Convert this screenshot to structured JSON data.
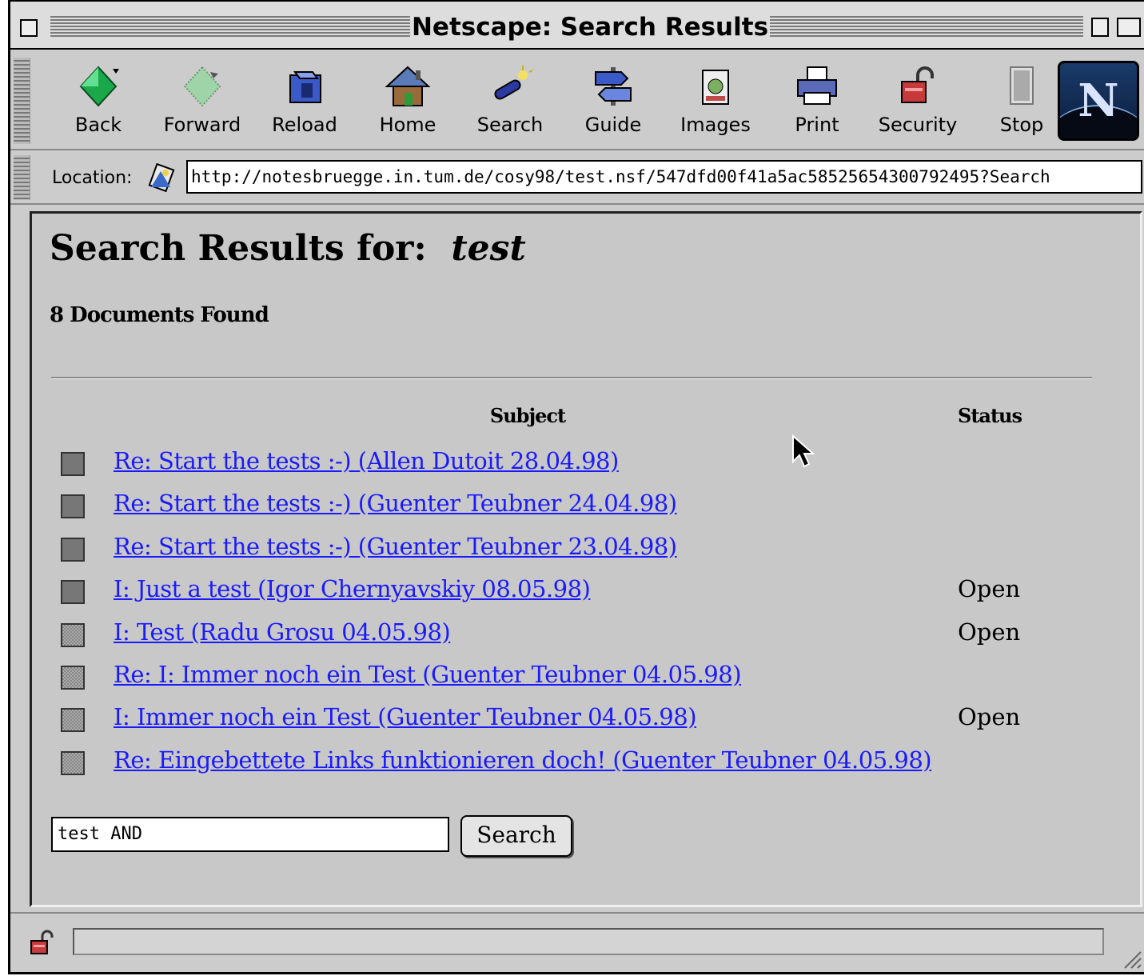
{
  "window": {
    "title": "Netscape: Search Results"
  },
  "toolbar": {
    "buttons": [
      {
        "label": "Back",
        "icon": "back-arrow-icon"
      },
      {
        "label": "Forward",
        "icon": "forward-arrow-icon"
      },
      {
        "label": "Reload",
        "icon": "reload-icon"
      },
      {
        "label": "Home",
        "icon": "home-icon"
      },
      {
        "label": "Search",
        "icon": "search-flashlight-icon"
      },
      {
        "label": "Guide",
        "icon": "guide-signpost-icon"
      },
      {
        "label": "Images",
        "icon": "images-icon"
      },
      {
        "label": "Print",
        "icon": "printer-icon"
      },
      {
        "label": "Security",
        "icon": "padlock-icon"
      },
      {
        "label": "Stop",
        "icon": "stop-icon"
      }
    ],
    "logo": "N"
  },
  "location": {
    "label": "Location:",
    "url": "http://notesbruegge.in.tum.de/cosy98/test.nsf/547dfd00f41a5ac58525654300792495?Search"
  },
  "page": {
    "heading_prefix": "Search Results for:",
    "heading_query": "test",
    "documents_found": "8 Documents Found",
    "columns": {
      "subject": "Subject",
      "status": "Status"
    },
    "results": [
      {
        "subject": "Re: Start the tests :-) (Allen Dutoit 28.04.98)",
        "status": "",
        "marker": "dark"
      },
      {
        "subject": "Re: Start the tests :-) (Guenter Teubner 24.04.98)",
        "status": "",
        "marker": "dark"
      },
      {
        "subject": "Re: Start the tests :-) (Guenter Teubner 23.04.98)",
        "status": "",
        "marker": "dark"
      },
      {
        "subject": "I: Just a test (Igor Chernyavskiy 08.05.98)",
        "status": "Open",
        "marker": "dark"
      },
      {
        "subject": "I: Test (Radu Grosu 04.05.98)",
        "status": "Open",
        "marker": "light"
      },
      {
        "subject": "Re: I: Immer noch ein Test (Guenter Teubner 04.05.98)",
        "status": "",
        "marker": "light"
      },
      {
        "subject": "I: Immer noch ein Test (Guenter Teubner 04.05.98)",
        "status": "Open",
        "marker": "light"
      },
      {
        "subject": "Re: Eingebettete Links funktionieren doch! (Guenter Teubner 04.05.98)",
        "status": "",
        "marker": "light"
      }
    ],
    "search": {
      "value": "test AND",
      "button_label": "Search"
    }
  },
  "statusbar": {
    "text": ""
  },
  "colors": {
    "link": "#1a1aff",
    "chrome": "#cccccc",
    "content_bg": "#c8c8c8"
  }
}
